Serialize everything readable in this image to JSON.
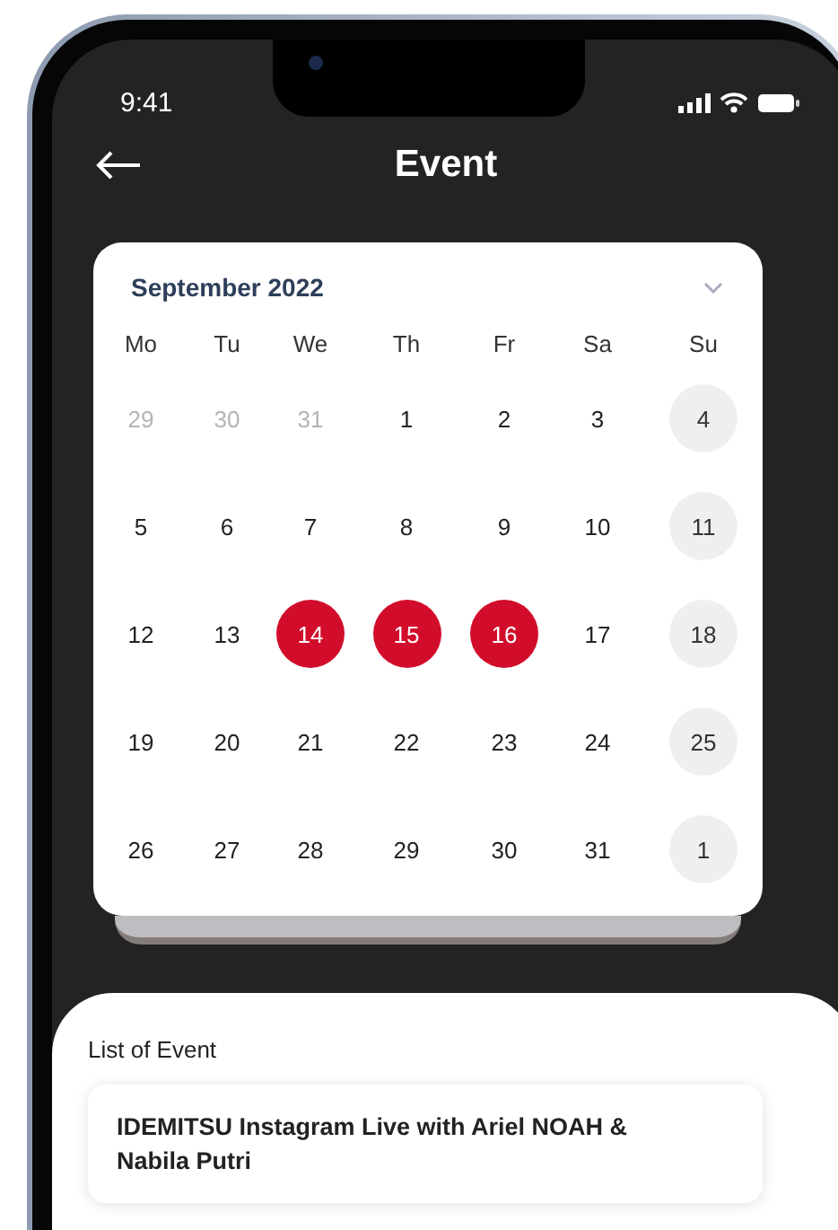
{
  "status_bar": {
    "time": "9:41"
  },
  "header": {
    "title": "Event"
  },
  "calendar": {
    "month": "September 2022",
    "weekdays": [
      "Mo",
      "Tu",
      "We",
      "Th",
      "Fr",
      "Sa",
      "Su"
    ],
    "weeks": [
      [
        {
          "day": "29",
          "kind": "outside"
        },
        {
          "day": "30",
          "kind": "outside"
        },
        {
          "day": "31",
          "kind": "outside"
        },
        {
          "day": "1",
          "kind": "day"
        },
        {
          "day": "2",
          "kind": "day"
        },
        {
          "day": "3",
          "kind": "day"
        },
        {
          "day": "4",
          "kind": "sunday"
        }
      ],
      [
        {
          "day": "5",
          "kind": "day"
        },
        {
          "day": "6",
          "kind": "day"
        },
        {
          "day": "7",
          "kind": "day"
        },
        {
          "day": "8",
          "kind": "day"
        },
        {
          "day": "9",
          "kind": "day"
        },
        {
          "day": "10",
          "kind": "day"
        },
        {
          "day": "11",
          "kind": "sunday"
        }
      ],
      [
        {
          "day": "12",
          "kind": "day"
        },
        {
          "day": "13",
          "kind": "day"
        },
        {
          "day": "14",
          "kind": "event"
        },
        {
          "day": "15",
          "kind": "event"
        },
        {
          "day": "16",
          "kind": "event"
        },
        {
          "day": "17",
          "kind": "day"
        },
        {
          "day": "18",
          "kind": "sunday"
        }
      ],
      [
        {
          "day": "19",
          "kind": "day"
        },
        {
          "day": "20",
          "kind": "day"
        },
        {
          "day": "21",
          "kind": "day"
        },
        {
          "day": "22",
          "kind": "day"
        },
        {
          "day": "23",
          "kind": "day"
        },
        {
          "day": "24",
          "kind": "day"
        },
        {
          "day": "25",
          "kind": "sunday"
        }
      ],
      [
        {
          "day": "26",
          "kind": "day"
        },
        {
          "day": "27",
          "kind": "day"
        },
        {
          "day": "28",
          "kind": "day"
        },
        {
          "day": "29",
          "kind": "day"
        },
        {
          "day": "30",
          "kind": "day"
        },
        {
          "day": "31",
          "kind": "day"
        },
        {
          "day": "1",
          "kind": "sunday"
        }
      ]
    ]
  },
  "event_list": {
    "heading": "List of Event",
    "events": [
      {
        "title": "IDEMITSU Instagram Live with Ariel NOAH & Nabila Putri"
      }
    ]
  }
}
